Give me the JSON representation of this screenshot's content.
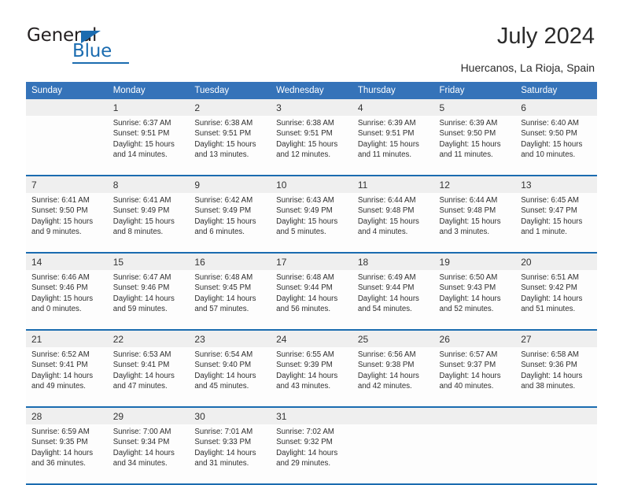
{
  "brand": {
    "name_top": "General",
    "name_bottom": "Blue",
    "accent_color": "#1b6cb0"
  },
  "header": {
    "title": "July 2024",
    "subtitle": "Huercanos, La Rioja, Spain"
  },
  "calendar": {
    "header_bg": "#3573b9",
    "daynum_bg": "#efefef",
    "separator_color": "#1b6cb0",
    "weekdays": [
      "Sunday",
      "Monday",
      "Tuesday",
      "Wednesday",
      "Thursday",
      "Friday",
      "Saturday"
    ],
    "weeks": [
      [
        {
          "day": ""
        },
        {
          "day": "1",
          "sunrise": "Sunrise: 6:37 AM",
          "sunset": "Sunset: 9:51 PM",
          "daylight_1": "Daylight: 15 hours",
          "daylight_2": "and 14 minutes."
        },
        {
          "day": "2",
          "sunrise": "Sunrise: 6:38 AM",
          "sunset": "Sunset: 9:51 PM",
          "daylight_1": "Daylight: 15 hours",
          "daylight_2": "and 13 minutes."
        },
        {
          "day": "3",
          "sunrise": "Sunrise: 6:38 AM",
          "sunset": "Sunset: 9:51 PM",
          "daylight_1": "Daylight: 15 hours",
          "daylight_2": "and 12 minutes."
        },
        {
          "day": "4",
          "sunrise": "Sunrise: 6:39 AM",
          "sunset": "Sunset: 9:51 PM",
          "daylight_1": "Daylight: 15 hours",
          "daylight_2": "and 11 minutes."
        },
        {
          "day": "5",
          "sunrise": "Sunrise: 6:39 AM",
          "sunset": "Sunset: 9:50 PM",
          "daylight_1": "Daylight: 15 hours",
          "daylight_2": "and 11 minutes."
        },
        {
          "day": "6",
          "sunrise": "Sunrise: 6:40 AM",
          "sunset": "Sunset: 9:50 PM",
          "daylight_1": "Daylight: 15 hours",
          "daylight_2": "and 10 minutes."
        }
      ],
      [
        {
          "day": "7",
          "sunrise": "Sunrise: 6:41 AM",
          "sunset": "Sunset: 9:50 PM",
          "daylight_1": "Daylight: 15 hours",
          "daylight_2": "and 9 minutes."
        },
        {
          "day": "8",
          "sunrise": "Sunrise: 6:41 AM",
          "sunset": "Sunset: 9:49 PM",
          "daylight_1": "Daylight: 15 hours",
          "daylight_2": "and 8 minutes."
        },
        {
          "day": "9",
          "sunrise": "Sunrise: 6:42 AM",
          "sunset": "Sunset: 9:49 PM",
          "daylight_1": "Daylight: 15 hours",
          "daylight_2": "and 6 minutes."
        },
        {
          "day": "10",
          "sunrise": "Sunrise: 6:43 AM",
          "sunset": "Sunset: 9:49 PM",
          "daylight_1": "Daylight: 15 hours",
          "daylight_2": "and 5 minutes."
        },
        {
          "day": "11",
          "sunrise": "Sunrise: 6:44 AM",
          "sunset": "Sunset: 9:48 PM",
          "daylight_1": "Daylight: 15 hours",
          "daylight_2": "and 4 minutes."
        },
        {
          "day": "12",
          "sunrise": "Sunrise: 6:44 AM",
          "sunset": "Sunset: 9:48 PM",
          "daylight_1": "Daylight: 15 hours",
          "daylight_2": "and 3 minutes."
        },
        {
          "day": "13",
          "sunrise": "Sunrise: 6:45 AM",
          "sunset": "Sunset: 9:47 PM",
          "daylight_1": "Daylight: 15 hours",
          "daylight_2": "and 1 minute."
        }
      ],
      [
        {
          "day": "14",
          "sunrise": "Sunrise: 6:46 AM",
          "sunset": "Sunset: 9:46 PM",
          "daylight_1": "Daylight: 15 hours",
          "daylight_2": "and 0 minutes."
        },
        {
          "day": "15",
          "sunrise": "Sunrise: 6:47 AM",
          "sunset": "Sunset: 9:46 PM",
          "daylight_1": "Daylight: 14 hours",
          "daylight_2": "and 59 minutes."
        },
        {
          "day": "16",
          "sunrise": "Sunrise: 6:48 AM",
          "sunset": "Sunset: 9:45 PM",
          "daylight_1": "Daylight: 14 hours",
          "daylight_2": "and 57 minutes."
        },
        {
          "day": "17",
          "sunrise": "Sunrise: 6:48 AM",
          "sunset": "Sunset: 9:44 PM",
          "daylight_1": "Daylight: 14 hours",
          "daylight_2": "and 56 minutes."
        },
        {
          "day": "18",
          "sunrise": "Sunrise: 6:49 AM",
          "sunset": "Sunset: 9:44 PM",
          "daylight_1": "Daylight: 14 hours",
          "daylight_2": "and 54 minutes."
        },
        {
          "day": "19",
          "sunrise": "Sunrise: 6:50 AM",
          "sunset": "Sunset: 9:43 PM",
          "daylight_1": "Daylight: 14 hours",
          "daylight_2": "and 52 minutes."
        },
        {
          "day": "20",
          "sunrise": "Sunrise: 6:51 AM",
          "sunset": "Sunset: 9:42 PM",
          "daylight_1": "Daylight: 14 hours",
          "daylight_2": "and 51 minutes."
        }
      ],
      [
        {
          "day": "21",
          "sunrise": "Sunrise: 6:52 AM",
          "sunset": "Sunset: 9:41 PM",
          "daylight_1": "Daylight: 14 hours",
          "daylight_2": "and 49 minutes."
        },
        {
          "day": "22",
          "sunrise": "Sunrise: 6:53 AM",
          "sunset": "Sunset: 9:41 PM",
          "daylight_1": "Daylight: 14 hours",
          "daylight_2": "and 47 minutes."
        },
        {
          "day": "23",
          "sunrise": "Sunrise: 6:54 AM",
          "sunset": "Sunset: 9:40 PM",
          "daylight_1": "Daylight: 14 hours",
          "daylight_2": "and 45 minutes."
        },
        {
          "day": "24",
          "sunrise": "Sunrise: 6:55 AM",
          "sunset": "Sunset: 9:39 PM",
          "daylight_1": "Daylight: 14 hours",
          "daylight_2": "and 43 minutes."
        },
        {
          "day": "25",
          "sunrise": "Sunrise: 6:56 AM",
          "sunset": "Sunset: 9:38 PM",
          "daylight_1": "Daylight: 14 hours",
          "daylight_2": "and 42 minutes."
        },
        {
          "day": "26",
          "sunrise": "Sunrise: 6:57 AM",
          "sunset": "Sunset: 9:37 PM",
          "daylight_1": "Daylight: 14 hours",
          "daylight_2": "and 40 minutes."
        },
        {
          "day": "27",
          "sunrise": "Sunrise: 6:58 AM",
          "sunset": "Sunset: 9:36 PM",
          "daylight_1": "Daylight: 14 hours",
          "daylight_2": "and 38 minutes."
        }
      ],
      [
        {
          "day": "28",
          "sunrise": "Sunrise: 6:59 AM",
          "sunset": "Sunset: 9:35 PM",
          "daylight_1": "Daylight: 14 hours",
          "daylight_2": "and 36 minutes."
        },
        {
          "day": "29",
          "sunrise": "Sunrise: 7:00 AM",
          "sunset": "Sunset: 9:34 PM",
          "daylight_1": "Daylight: 14 hours",
          "daylight_2": "and 34 minutes."
        },
        {
          "day": "30",
          "sunrise": "Sunrise: 7:01 AM",
          "sunset": "Sunset: 9:33 PM",
          "daylight_1": "Daylight: 14 hours",
          "daylight_2": "and 31 minutes."
        },
        {
          "day": "31",
          "sunrise": "Sunrise: 7:02 AM",
          "sunset": "Sunset: 9:32 PM",
          "daylight_1": "Daylight: 14 hours",
          "daylight_2": "and 29 minutes."
        },
        {
          "day": ""
        },
        {
          "day": ""
        },
        {
          "day": ""
        }
      ]
    ]
  }
}
